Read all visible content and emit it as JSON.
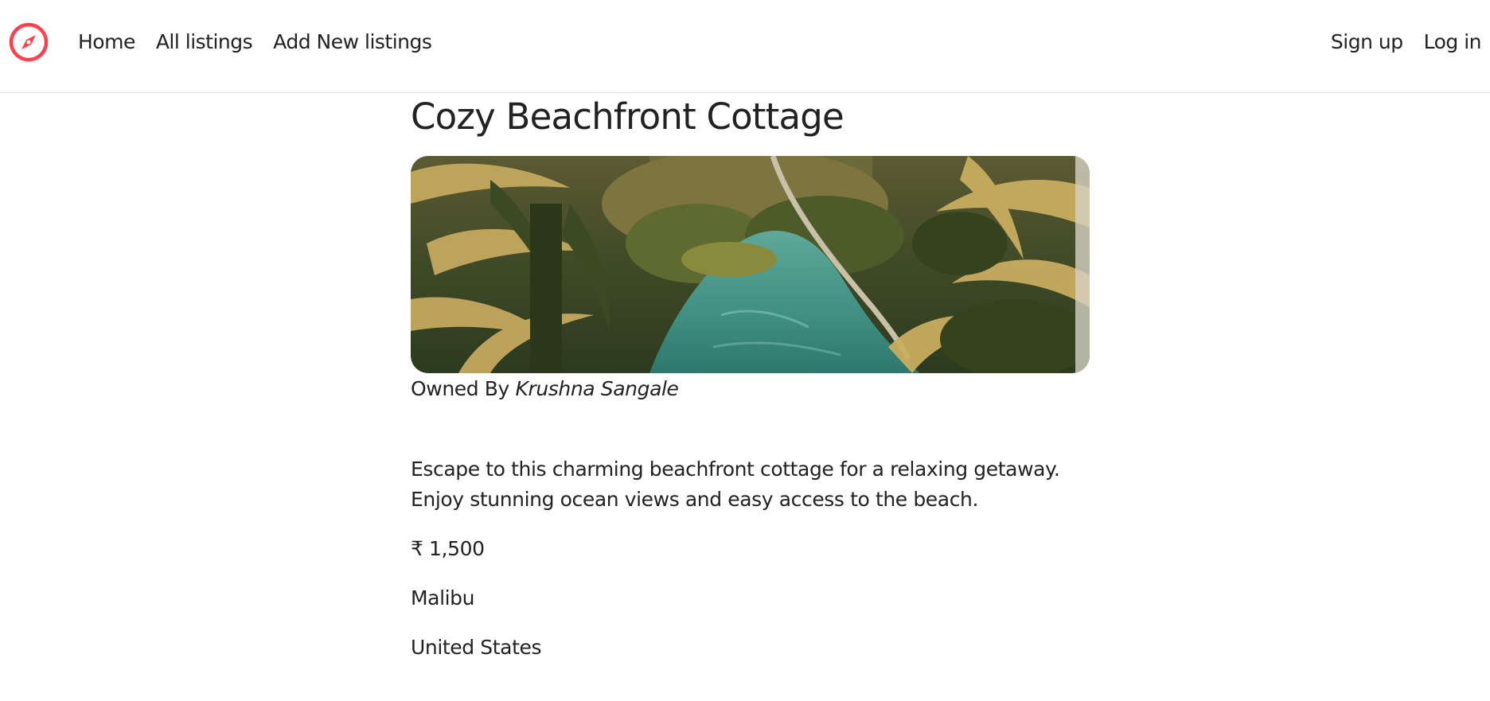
{
  "navbar": {
    "logo_icon": "compass-icon",
    "brand_color": "#fe424d",
    "left_links": [
      "Home",
      "All listings",
      "Add New listings"
    ],
    "right_links": [
      "Sign up",
      "Log in"
    ]
  },
  "listing": {
    "title": "Cozy Beachfront Cottage",
    "image_subject": "tropical-palm-lagoon",
    "owner_prefix": "Owned By",
    "owner_name": "Krushna Sangale",
    "description": "Escape to this charming beachfront cottage for a relaxing getaway. Enjoy stunning ocean views and easy access to the beach.",
    "price": "₹ 1,500",
    "location": "Malibu",
    "country": "United States"
  }
}
